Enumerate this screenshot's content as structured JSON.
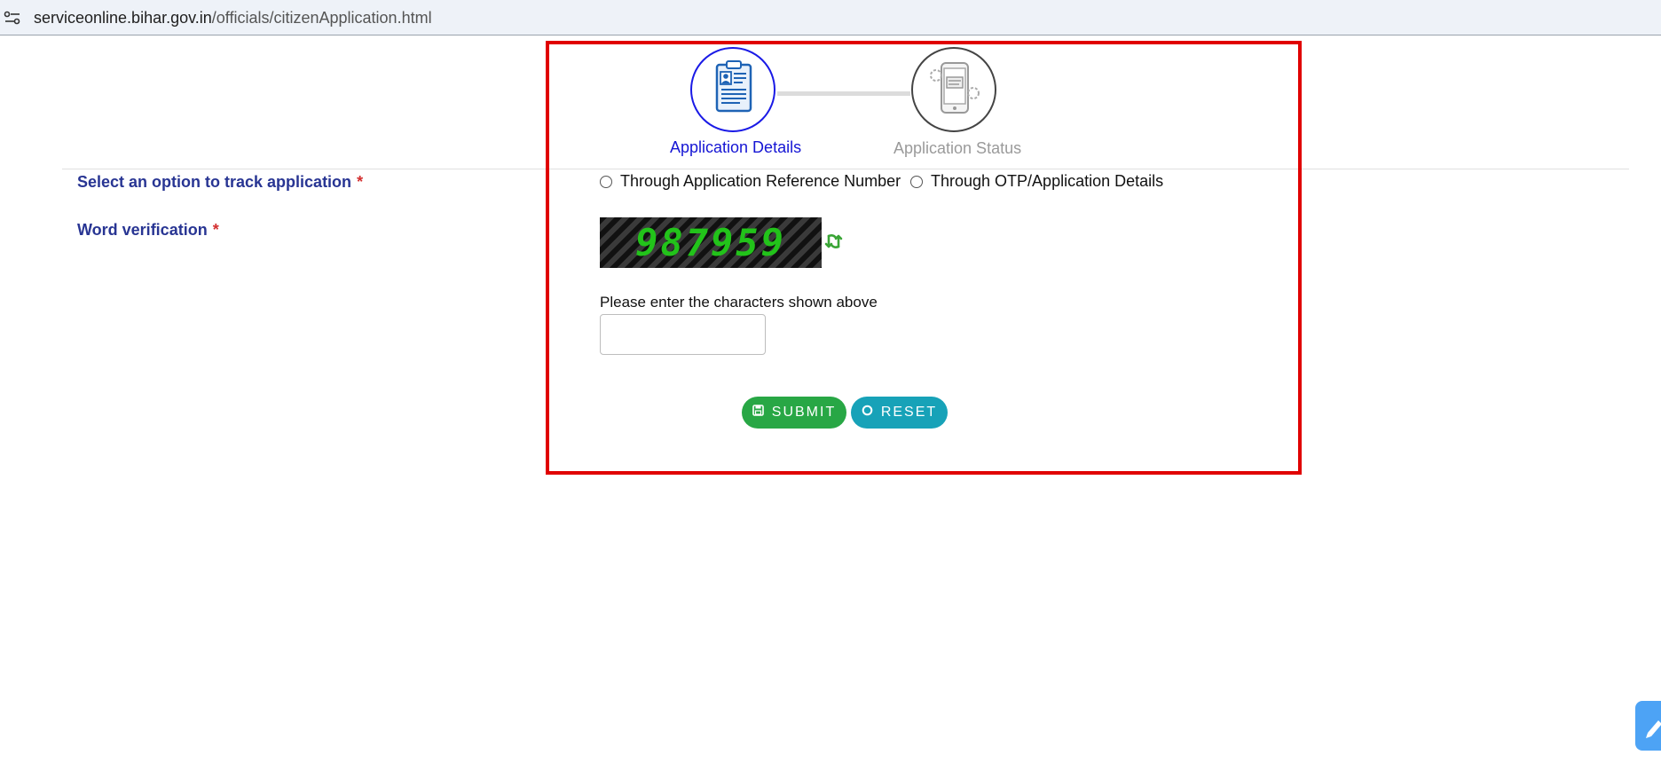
{
  "browser": {
    "url_domain": "serviceonline.bihar.gov.in",
    "url_path": "/officials/citizenApplication.html"
  },
  "stepper": {
    "steps": [
      {
        "label": "Application Details",
        "state": "active",
        "icon": "clipboard-document-icon"
      },
      {
        "label": "Application Status",
        "state": "inactive",
        "icon": "mobile-status-icon"
      }
    ],
    "active_color": "#1a1ae6"
  },
  "form": {
    "track_label": "Select an option to track application",
    "required_mark": "*",
    "track_options": [
      {
        "label": "Through Application Reference Number",
        "selected": false
      },
      {
        "label": "Through OTP/Application Details",
        "selected": false
      }
    ],
    "word_label": "Word verification",
    "captcha_text": "987959",
    "captcha_hint": "Please enter the characters shown above",
    "captcha_value": "",
    "submit_label": "SUBMIT",
    "reset_label": "RESET"
  },
  "colors": {
    "label": "#283593",
    "required": "#d32f2f",
    "submit": "#28a745",
    "reset": "#17a2b8",
    "highlight_box": "#e00000",
    "captcha_text": "#22c31a"
  }
}
